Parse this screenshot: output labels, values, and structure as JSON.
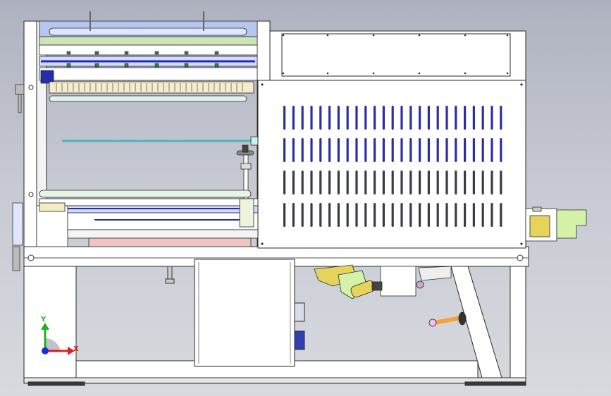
{
  "colors": {
    "background_top": "#aeb2c0",
    "background_bottom": "#d8dadf",
    "frame_fill": "#ffffff",
    "outline": "#2a2a2a",
    "roller_blue": "#b7c6ee",
    "dark_blue": "#1f2fb0",
    "cyan_rod": "#3fb6b6",
    "green_part": "#d5f3a8",
    "yellow_part": "#e6d35a",
    "pink_plate": "#f1c4c4",
    "orange_arm": "#f2a23c",
    "axis_x": "#e02020",
    "axis_y": "#20b020",
    "axis_z": "#2030d0"
  },
  "triad": {
    "x_label": "X",
    "y_label": "Y"
  }
}
